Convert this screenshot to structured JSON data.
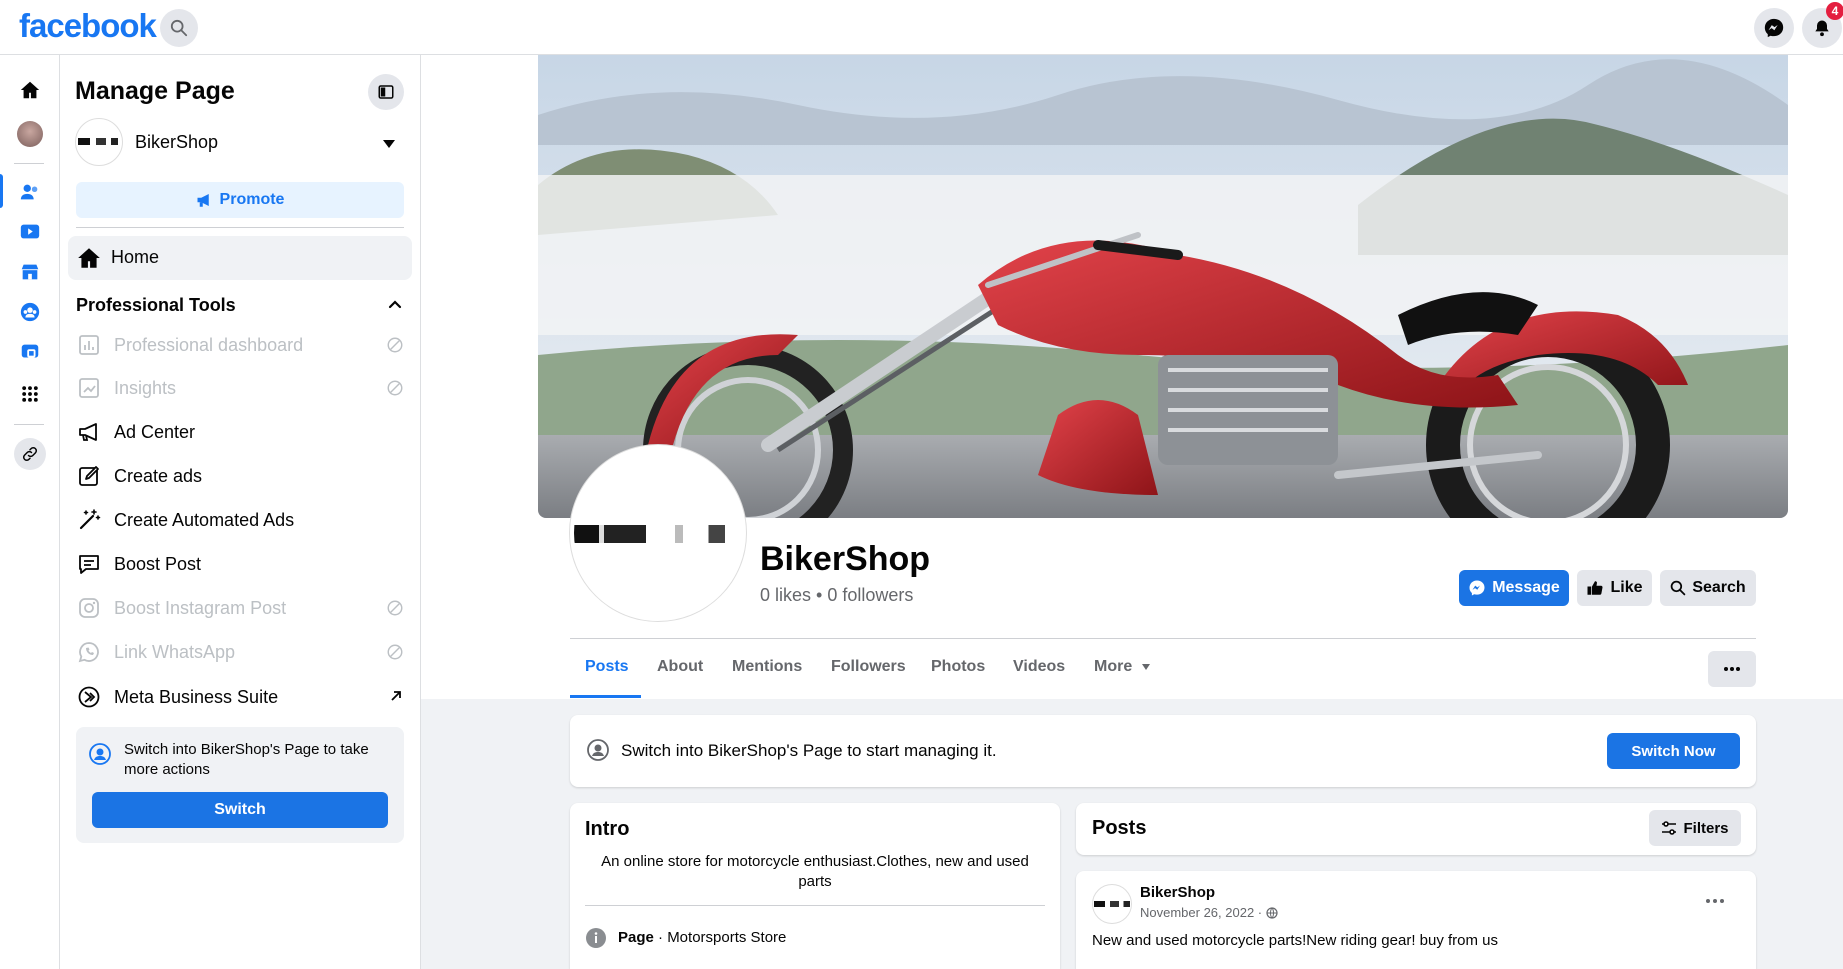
{
  "topbar": {
    "logo": "facebook",
    "notification_count": "4"
  },
  "sidebar": {
    "title": "Manage Page",
    "page_name": "BikerShop",
    "promote_label": "Promote",
    "home_label": "Home",
    "section_title": "Professional Tools",
    "items": [
      {
        "label": "Professional dashboard",
        "icon": "dashboard-icon",
        "disabled": true
      },
      {
        "label": "Insights",
        "icon": "insights-icon",
        "disabled": true
      },
      {
        "label": "Ad Center",
        "icon": "megaphone-icon",
        "disabled": false
      },
      {
        "label": "Create ads",
        "icon": "edit-icon",
        "disabled": false
      },
      {
        "label": "Create Automated Ads",
        "icon": "magic-wand-icon",
        "disabled": false
      },
      {
        "label": "Boost Post",
        "icon": "boost-post-icon",
        "disabled": false
      },
      {
        "label": "Boost Instagram Post",
        "icon": "instagram-icon",
        "disabled": true
      },
      {
        "label": "Link WhatsApp",
        "icon": "whatsapp-icon",
        "disabled": true
      },
      {
        "label": "Meta Business Suite",
        "icon": "meta-business-icon",
        "disabled": false
      }
    ],
    "switch_text": "Switch into BikerShop's Page to take more actions",
    "switch_button": "Switch"
  },
  "page": {
    "name": "BikerShop",
    "stats": "0 likes • 0 followers",
    "message_button": "Message",
    "like_button": "Like",
    "search_button": "Search",
    "tabs": [
      "Posts",
      "About",
      "Mentions",
      "Followers",
      "Photos",
      "Videos",
      "More"
    ],
    "active_tab": "Posts"
  },
  "banner": {
    "text": "Switch into BikerShop's Page to start managing it.",
    "button": "Switch Now"
  },
  "intro": {
    "title": "Intro",
    "bio": "An online store for motorcycle enthusiast.Clothes, new and used parts",
    "category_label": "Page",
    "category_value": " · Motorsports Store"
  },
  "posts": {
    "title": "Posts",
    "filters_button": "Filters",
    "items": [
      {
        "author": "BikerShop",
        "date": "November 26, 2022 ·",
        "text": "New and used motorcycle parts!New riding gear! buy from us"
      }
    ]
  },
  "colors": {
    "brand": "#1877f2",
    "button_primary": "#1b74e4",
    "background": "#f0f2f5"
  }
}
